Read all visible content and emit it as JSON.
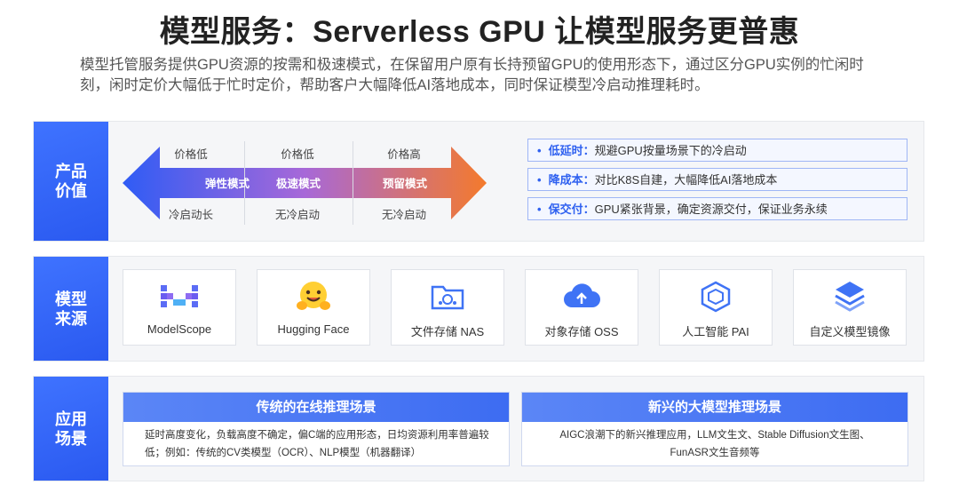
{
  "title": "模型服务：Serverless GPU 让模型服务更普惠",
  "subtitle": "模型托管服务提供GPU资源的按需和极速模式，在保留用户原有长持预留GPU的使用形态下，通过区分GPU实例的忙闲时刻，闲时定价大幅低于忙时定价，帮助客户大幅降低AI落地成本，同时保证模型冷启动推理耗时。",
  "product_value": {
    "tag": "产品价值",
    "modes": [
      {
        "price": "价格低",
        "name": "弹性模式",
        "start": "冷启动长"
      },
      {
        "price": "价格低",
        "name": "极速模式",
        "start": "无冷启动"
      },
      {
        "price": "价格高",
        "name": "预留模式",
        "start": "无冷启动"
      }
    ],
    "benefits": [
      {
        "key": "低延时：",
        "text": "规避GPU按量场景下的冷启动"
      },
      {
        "key": "降成本：",
        "text": "对比K8S自建，大幅降低AI落地成本"
      },
      {
        "key": "保交付：",
        "text": "GPU紧张背景，确定资源交付，保证业务永续"
      }
    ]
  },
  "model_source": {
    "tag": "模型来源",
    "items": [
      {
        "label": "ModelScope",
        "icon": "modelscope-logo-icon"
      },
      {
        "label": "Hugging Face",
        "icon": "hugging-face-emoji-icon"
      },
      {
        "label": "文件存储 NAS",
        "icon": "nas-folder-icon"
      },
      {
        "label": "对象存储 OSS",
        "icon": "oss-cloud-upload-icon"
      },
      {
        "label": "人工智能 PAI",
        "icon": "pai-cube-icon"
      },
      {
        "label": "自定义模型镜像",
        "icon": "layers-stack-icon"
      }
    ]
  },
  "scenarios": {
    "tag": "应用场景",
    "traditional": {
      "title": "传统的在线推理场景",
      "desc": "延时高度变化，负载高度不确定，偏C端的应用形态，日均资源利用率普遍较低；例如：传统的CV类模型（OCR）、NLP模型（机器翻译）"
    },
    "emerging": {
      "title": "新兴的大模型推理场景",
      "desc_line1": "AIGC浪潮下的新兴推理应用，LLM文生文、Stable Diffusion文生图、",
      "desc_line2": "FunASR文生音频等"
    }
  },
  "colors": {
    "accent": "#2f61f0",
    "arrow_left": "#2f5cf5",
    "arrow_mid": "#a768d8",
    "arrow_right": "#f47a2c"
  }
}
